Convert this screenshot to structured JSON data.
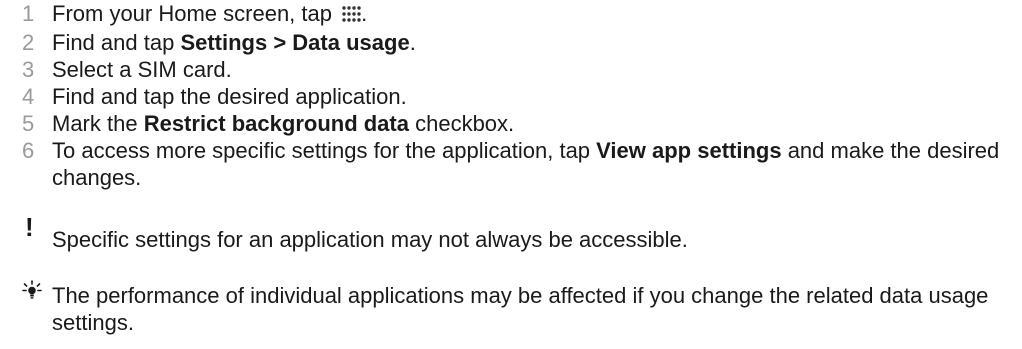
{
  "steps": [
    {
      "number": "1",
      "before": "From your Home screen, tap ",
      "icon": "apps-grid-icon",
      "after": "."
    },
    {
      "number": "2",
      "before": "Find and tap ",
      "bold": "Settings > Data usage",
      "after": "."
    },
    {
      "number": "3",
      "text": "Select a SIM card."
    },
    {
      "number": "4",
      "text": "Find and tap the desired application."
    },
    {
      "number": "5",
      "before": "Mark the ",
      "bold": "Restrict background data",
      "after": " checkbox."
    },
    {
      "number": "6",
      "before": "To access more specific settings for the application, tap ",
      "bold": "View app settings",
      "after": " and make the desired changes."
    }
  ],
  "notes": {
    "warning": {
      "icon": "exclamation-icon",
      "text": "Specific settings for an application may not always be accessible."
    },
    "tip": {
      "icon": "lightbulb-tip-icon",
      "text": "The performance of individual applications may be affected if you change the related data usage settings."
    }
  },
  "colors": {
    "text": "#1a1a1a",
    "step_number": "#9a9a9a"
  }
}
